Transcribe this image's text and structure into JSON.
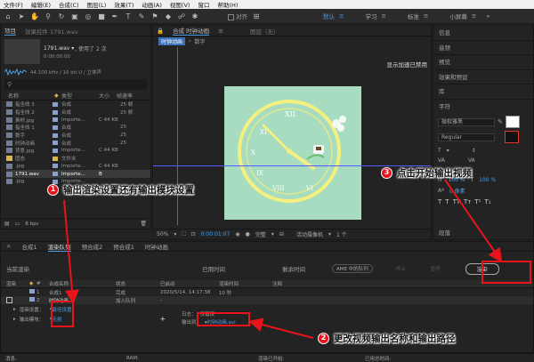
{
  "menu": [
    "文件(F)",
    "编辑(E)",
    "合成(C)",
    "图层(L)",
    "效果(T)",
    "动画(A)",
    "视图(V)",
    "窗口",
    "帮助(H)"
  ],
  "toolbar": {
    "snap_label": "对齐",
    "workspaces": [
      "默认",
      "学习",
      "标准",
      "小屏幕"
    ]
  },
  "project": {
    "tab": "项目",
    "effect_tab": "效果控件 1791.wav",
    "file_name": "1791.wav ▾",
    "used_text": ", 使用了 2 次",
    "duration": "0:00:00:00",
    "audio_info": "44.100 kHz / 16 bit U / 立体声",
    "columns": {
      "name": "名称",
      "type": "类型",
      "size": "大小",
      "rate": "帧速率"
    },
    "items": [
      {
        "name": "指全线 3",
        "type": "合成",
        "size": "",
        "rate": "25 帧",
        "color": "#8aa1d0",
        "icon": "comp-icon"
      },
      {
        "name": "指全线 2",
        "type": "合成",
        "size": "",
        "rate": "25 帧",
        "color": "#8aa1d0",
        "icon": "comp-icon"
      },
      {
        "name": "素材.jpg",
        "type": "Importe...",
        "size": "C 44 KB",
        "rate": "",
        "color": "#8aa1d0",
        "icon": "image-icon"
      },
      {
        "name": "指全线 1",
        "type": "合成",
        "size": "",
        "rate": "25",
        "color": "#8aa1d0",
        "icon": "comp-icon"
      },
      {
        "name": "数字",
        "type": "合成",
        "size": "",
        "rate": "25",
        "color": "#8aa1d0",
        "icon": "comp-icon"
      },
      {
        "name": "时钟动画",
        "type": "合成",
        "size": "",
        "rate": "25",
        "color": "#8aa1d0",
        "icon": "comp-icon"
      },
      {
        "name": "背景.jpg",
        "type": "Importe...",
        "size": "C 44 KB",
        "rate": "",
        "color": "#8aa1d0",
        "icon": "image-icon"
      },
      {
        "name": "固态",
        "type": "文件夹",
        "size": "",
        "rate": "",
        "color": "#d9b84b",
        "icon": "folder-icon"
      },
      {
        "name": ".jpg",
        "type": "Importe...",
        "size": "C 44 KB",
        "rate": "",
        "color": "#8aa1d0",
        "icon": "image-icon"
      },
      {
        "name": "1791.wav",
        "type": "Importe...",
        "size": "B",
        "rate": "",
        "color": "#8aa1d0",
        "icon": "audio-icon",
        "selected": true
      },
      {
        "name": ".jpg",
        "type": "Importe...",
        "size": "",
        "rate": "",
        "color": "#8aa1d0",
        "icon": "image-icon"
      }
    ],
    "bpc": "8 bpc"
  },
  "comp": {
    "tab": "合成 时钟动画",
    "layer_tab": "图层（无）",
    "crumb_active": "时钟动画",
    "crumb": "数字",
    "title_safe": "显示加速已禁用",
    "zoom": "50%",
    "time": "0:00:01:07",
    "quality": "完整",
    "camera": "活动摄像机",
    "views": "1 个"
  },
  "right": {
    "items": [
      "信息",
      "音频",
      "预览",
      "效果和预设",
      "库",
      "字符"
    ],
    "font": "微软雅黑",
    "style": "Regular",
    "tracking": "100 %",
    "paragraph": "段落"
  },
  "render": {
    "tabs": [
      "合成1",
      "渲染队列",
      "预合成2",
      "预合成1",
      "时钟动画"
    ],
    "current_render": "当前渲染",
    "elapsed": "已用时间",
    "remaining": "剩余时间",
    "ame": "AME 中的队列",
    "stop": "停止",
    "pause": "暂停",
    "render_button": "渲染",
    "cols": [
      "渲染",
      "标签",
      "#",
      "合成名称",
      "状态",
      "已启动",
      "渲染时间",
      "注释"
    ],
    "rows": [
      {
        "num": "1",
        "name": "合成1",
        "status": "完成",
        "start": "2020/5/14, 14:17:38",
        "time": "10 秒"
      },
      {
        "num": "2",
        "name": "时钟动画",
        "status": "加入队列",
        "start": "-",
        "time": ""
      }
    ],
    "settings_label": "渲染设置：",
    "settings_value": "最佳设置",
    "module_label": "输出模块：",
    "module_value": "无损",
    "log_label": "日志：",
    "log_value": "仅错误",
    "output_label": "输出到：",
    "output_value": "时钟动画.avi"
  },
  "status": {
    "msg": "消息:",
    "ram": "RAM:",
    "started": "渲染已开始:",
    "total": "已用总时间:"
  },
  "annotations": [
    {
      "num": "1",
      "text": "输出渲染设置还有输出模块设置"
    },
    {
      "num": "2",
      "text": "更改视频输出名称和输出路径"
    },
    {
      "num": "3",
      "text": "点击开始输出视频"
    }
  ]
}
